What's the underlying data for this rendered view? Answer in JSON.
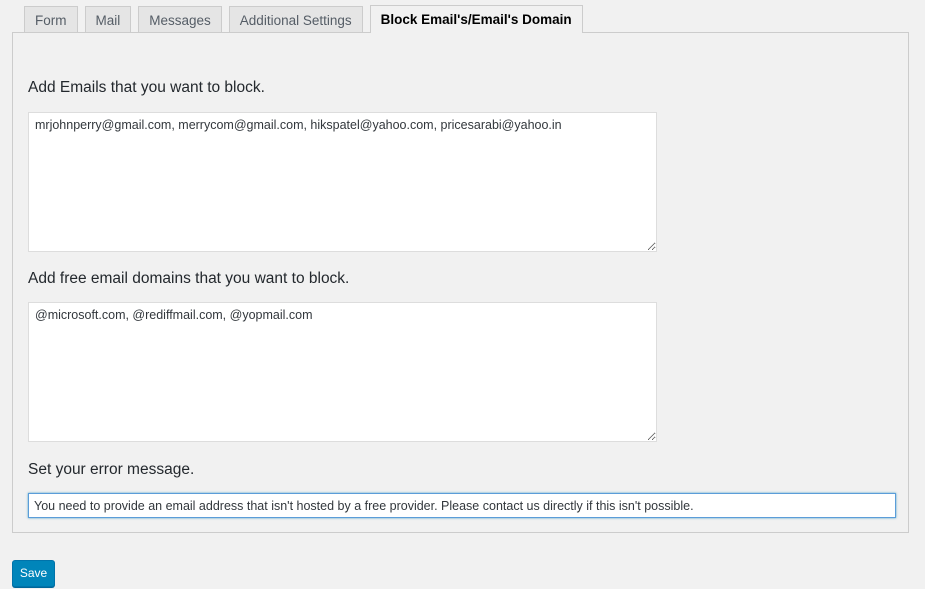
{
  "tabs": [
    {
      "label": "Form",
      "active": false
    },
    {
      "label": "Mail",
      "active": false
    },
    {
      "label": "Messages",
      "active": false
    },
    {
      "label": "Additional Settings",
      "active": false
    },
    {
      "label": "Block Email's/Email's Domain",
      "active": true
    }
  ],
  "block_emails": {
    "label": "Add Emails that you want to block.",
    "value": "mrjohnperry@gmail.com, merrycom@gmail.com, hikspatel@yahoo.com, pricesarabi@yahoo.in"
  },
  "block_domains": {
    "label": "Add free email domains that you want to block.",
    "value": "@microsoft.com, @rediffmail.com, @yopmail.com"
  },
  "error_message": {
    "label": "Set your error message.",
    "value": "You need to provide an email address that isn't hosted by a free provider. Please contact us directly if this isn't possible."
  },
  "actions": {
    "save_label": "Save"
  }
}
